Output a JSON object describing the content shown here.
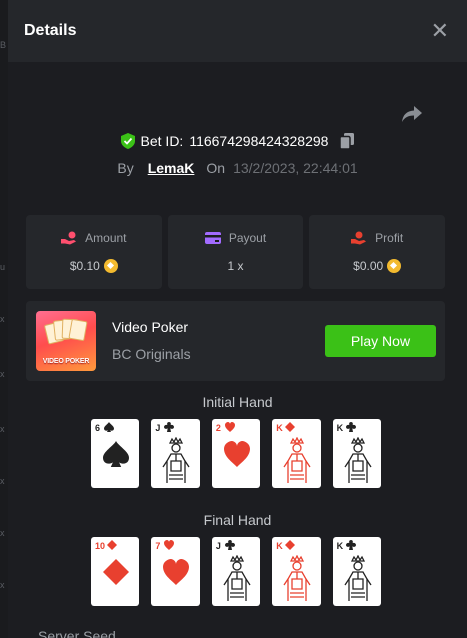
{
  "header": {
    "title": "Details"
  },
  "bet": {
    "id_label": "Bet ID:",
    "id_value": "116674298424328298",
    "by_label": "By",
    "user": "LemaK",
    "on_label": "On",
    "date": "13/2/2023, 22:44:01"
  },
  "stats": {
    "amount": {
      "label": "Amount",
      "value": "$0.10"
    },
    "payout": {
      "label": "Payout",
      "value": "1 x"
    },
    "profit": {
      "label": "Profit",
      "value": "$0.00"
    }
  },
  "game": {
    "name": "Video Poker",
    "provider": "BC Originals",
    "thumb_text": "VIDEO POKER",
    "play_label": "Play Now"
  },
  "hands": {
    "initial": {
      "title": "Initial Hand",
      "cards": [
        {
          "rank": "6",
          "suit": "spade"
        },
        {
          "rank": "J",
          "suit": "club"
        },
        {
          "rank": "2",
          "suit": "heart"
        },
        {
          "rank": "K",
          "suit": "diamond"
        },
        {
          "rank": "K",
          "suit": "club"
        }
      ]
    },
    "final": {
      "title": "Final Hand",
      "cards": [
        {
          "rank": "10",
          "suit": "diamond"
        },
        {
          "rank": "7",
          "suit": "heart"
        },
        {
          "rank": "J",
          "suit": "club"
        },
        {
          "rank": "K",
          "suit": "diamond"
        },
        {
          "rank": "K",
          "suit": "club"
        }
      ]
    }
  },
  "next_section": "Server Seed",
  "colors": {
    "accent_green": "#3bc117",
    "red_suit": "#e8402f",
    "black_suit": "#222222",
    "coin": "#f3ba2f",
    "amount_icon": "#ff4f6e",
    "payout_icon": "#a26bff",
    "profit_icon": "#e8402f"
  }
}
